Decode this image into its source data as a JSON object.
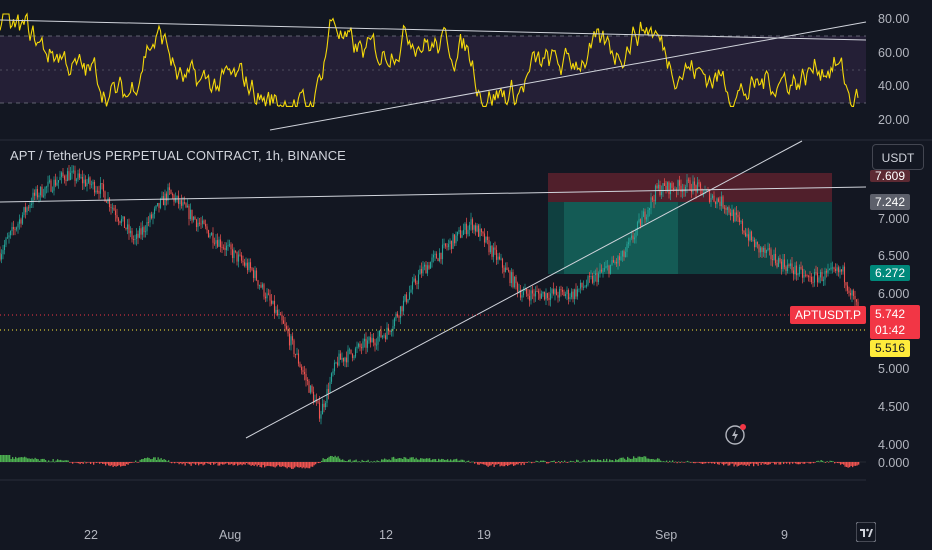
{
  "header": {
    "title": "APT / TetherUS PERPETUAL CONTRACT, 1h, BINANCE",
    "currency_button": "USDT"
  },
  "rsi_axis": [
    "80.00",
    "60.00",
    "40.00",
    "20.00"
  ],
  "price_axis": [
    "7.609",
    "7.000",
    "6.500",
    "6.000",
    "5.000",
    "4.500",
    "4.000"
  ],
  "osc_axis": [
    "0.000"
  ],
  "price_tags": {
    "target": "7.242",
    "entry": "6.272",
    "symbol": "APTUSDT.P",
    "last": "5.742",
    "countdown": "01:42",
    "level": "5.516"
  },
  "time_axis": [
    "22",
    "Aug",
    "12",
    "19",
    "Sep",
    "9"
  ],
  "colors": {
    "background": "#131722",
    "up": "#26a69a",
    "down": "#ef5350",
    "rsi_line": "#f5d90a",
    "rsi_band": "#2a2540",
    "target_zone": "#089981",
    "stop_zone": "#f23645",
    "level_tag": "#ffeb3b",
    "tag_gray": "#5d606b",
    "tag_teal": "#00897b"
  },
  "chart_data": {
    "type": "candlestick",
    "symbol": "APT / TetherUS PERPETUAL CONTRACT",
    "interval": "1h",
    "exchange": "BINANCE",
    "price_range": [
      4.0,
      7.6
    ],
    "price_path": [
      {
        "x": "Jul 16",
        "y": 6.55
      },
      {
        "x": "Jul 18",
        "y": 7.3
      },
      {
        "x": "Jul 20",
        "y": 7.6
      },
      {
        "x": "Jul 22",
        "y": 7.4
      },
      {
        "x": "Jul 24",
        "y": 6.7
      },
      {
        "x": "Jul 26",
        "y": 7.35
      },
      {
        "x": "Jul 28",
        "y": 6.9
      },
      {
        "x": "Jul 31",
        "y": 6.3
      },
      {
        "x": "Aug 2",
        "y": 5.5
      },
      {
        "x": "Aug 4",
        "y": 4.4
      },
      {
        "x": "Aug 5",
        "y": 5.1
      },
      {
        "x": "Aug 8",
        "y": 5.5
      },
      {
        "x": "Aug 10",
        "y": 6.3
      },
      {
        "x": "Aug 13",
        "y": 6.95
      },
      {
        "x": "Aug 16",
        "y": 6.0
      },
      {
        "x": "Aug 19",
        "y": 6.0
      },
      {
        "x": "Aug 22",
        "y": 6.5
      },
      {
        "x": "Aug 24",
        "y": 7.4
      },
      {
        "x": "Aug 26",
        "y": 7.45
      },
      {
        "x": "Aug 28",
        "y": 7.2
      },
      {
        "x": "Aug 30",
        "y": 6.6
      },
      {
        "x": "Sep 2",
        "y": 6.2
      },
      {
        "x": "Sep 4",
        "y": 6.3
      },
      {
        "x": "Sep 5",
        "y": 5.74
      }
    ],
    "position": {
      "entry": 6.272,
      "target": 7.242,
      "stop": 7.609
    },
    "horizontal_level": 5.516,
    "rsi_bands": [
      30,
      70
    ]
  }
}
